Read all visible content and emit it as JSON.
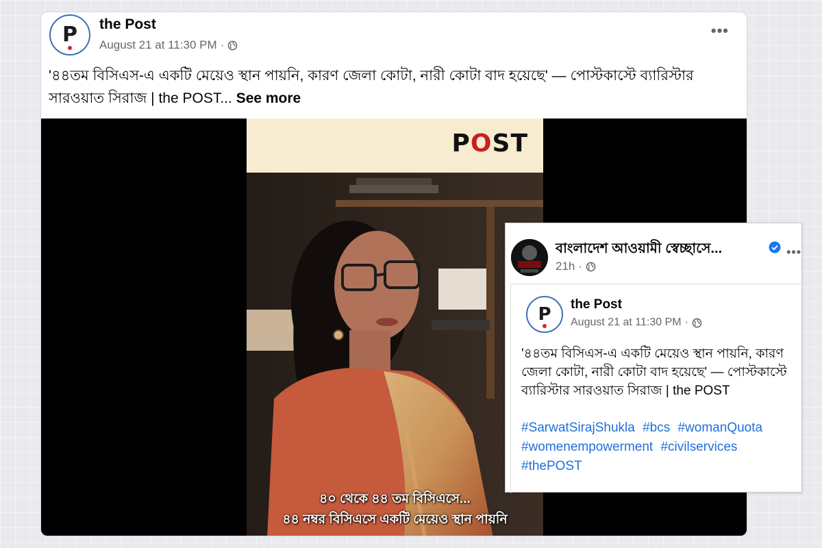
{
  "main_post": {
    "page_name": "the Post",
    "timestamp": "August 21 at 11:30 PM",
    "separator": "·",
    "more": "•••",
    "text": "'৪৪তম বিসিএস-এ একটি  মেয়েও স্থান পায়নি, কারণ জেলা কোটা, নারী কোটা বাদ হয়েছে' — পোস্টকাস্টে ব্যারিস্টার সারওয়াত সিরাজ | the POST...",
    "see_more": "See more",
    "video": {
      "banner_logo_left": "P",
      "banner_logo_o": "O",
      "banner_logo_right": "ST",
      "caption_line1": "৪০ থেকে ৪৪ তম বিসিএসে...",
      "caption_line2": "৪৪ নম্বর বিসিএসে একটি মেয়েও স্থান পায়নি"
    }
  },
  "shared_card": {
    "sharer_name": "বাংলাদেশ আওয়ামী স্বেচ্ছাসে...",
    "time": "21h",
    "separator": "·",
    "more": "•••",
    "inner_post": {
      "page_name": "the Post",
      "timestamp": "August 21 at 11:30 PM",
      "separator": "·",
      "text": "'৪৪তম বিসিএস-এ একটি  মেয়েও স্থান পায়নি, কারণ জেলা কোটা, নারী কোটা বাদ হয়েছে' — পোস্টকাস্টে ব্যারিস্টার সারওয়াত সিরাজ | the POST",
      "hashtags": [
        "#SarwatSirajShukla",
        "#bcs",
        "#womanQuota",
        "#womenempowerment",
        "#civilservices",
        "#thePOST"
      ]
    }
  },
  "colors": {
    "link": "#216fdb",
    "avatar_ring": "#3f6fb7",
    "logo_red": "#d3232a",
    "verified": "#1877f2",
    "banner_bg": "#f7ecd0"
  },
  "icons": [
    "globe-icon",
    "verified-icon",
    "more-options-icon",
    "post-logo-icon"
  ]
}
